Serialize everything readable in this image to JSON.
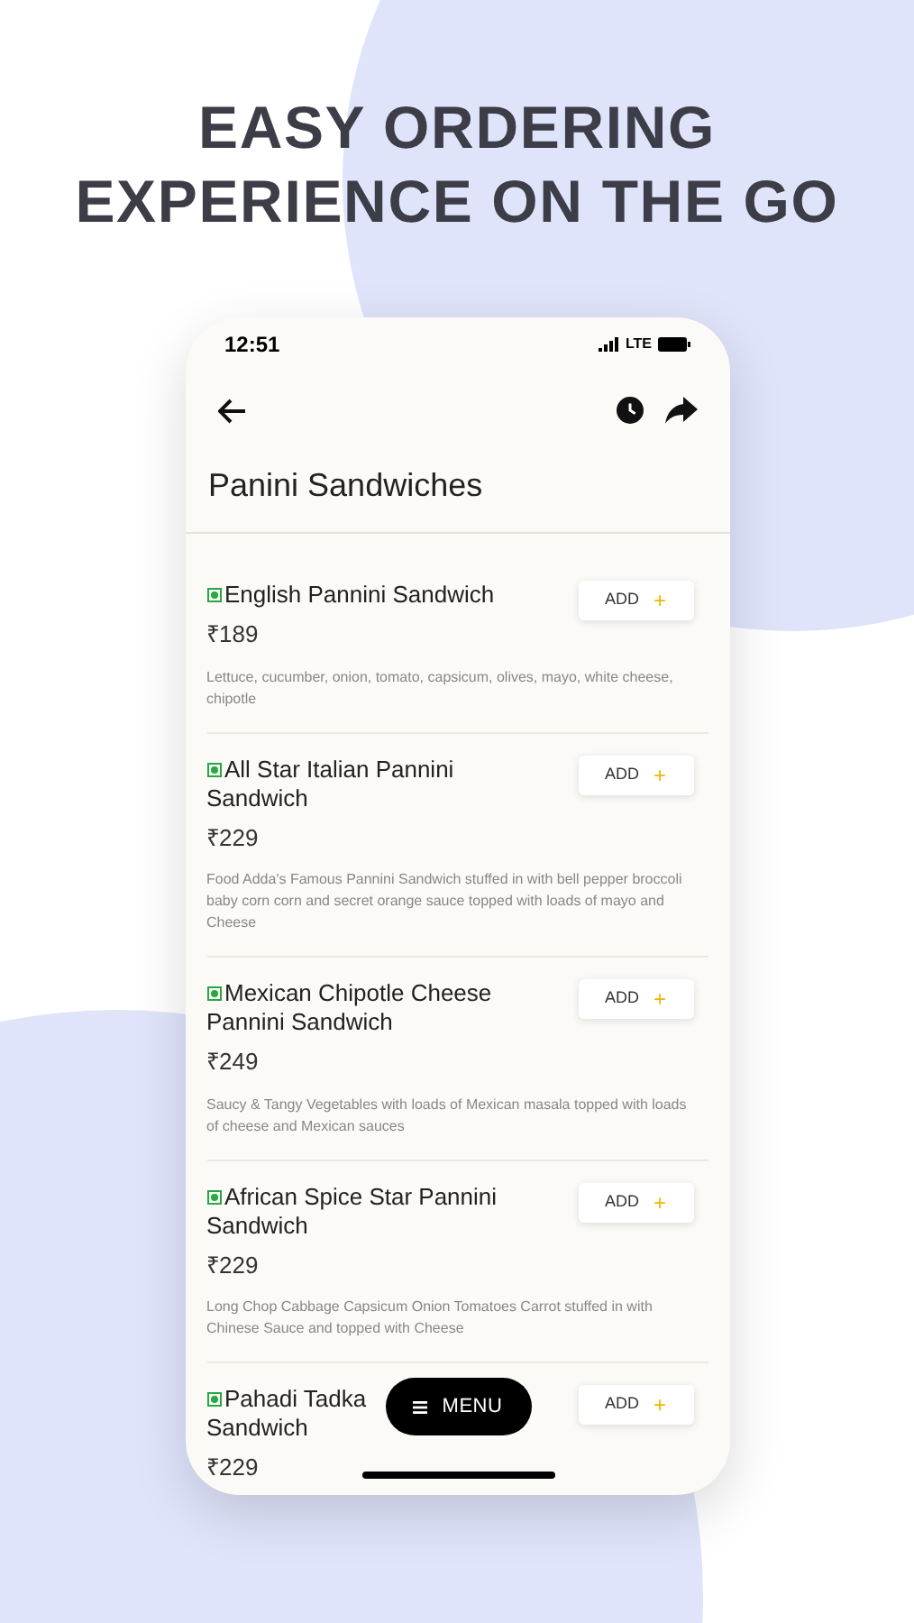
{
  "headline": [
    "EASY ORDERING",
    "EXPERIENCE ON THE GO"
  ],
  "status_bar": {
    "time": "12:51",
    "network": "LTE"
  },
  "title": "Panini Sandwiches",
  "items": [
    {
      "name": [
        "English Pannini Sandwich"
      ],
      "price": "₹189",
      "description": "Lettuce, cucumber, onion, tomato, capsicum, olives, mayo, white cheese, chipotle",
      "button": "ADD",
      "button_icon": "+"
    },
    {
      "name": [
        "All Star Italian Pannini",
        "Sandwich"
      ],
      "price": "₹229",
      "description": "Food Adda's Famous Pannini Sandwich stuffed in with bell pepper broccoli baby corn corn and secret orange sauce topped with loads of mayo and Cheese",
      "button": "ADD",
      "button_icon": "+"
    },
    {
      "name": [
        "Mexican Chipotle Cheese",
        "Pannini Sandwich"
      ],
      "price": "₹249",
      "description": "Saucy & Tangy Vegetables with loads of Mexican masala topped with loads of cheese and Mexican sauces",
      "button": "ADD",
      "button_icon": "+"
    },
    {
      "name": [
        "African Spice Star Pannini",
        "Sandwich"
      ],
      "price": "₹229",
      "description": "Long Chop Cabbage Capsicum Onion Tomatoes Carrot stuffed in with Chinese Sauce and topped with Cheese",
      "button": "ADD",
      "button_icon": "+"
    },
    {
      "name": [
        "Pahadi Tadka",
        "Sandwich"
      ],
      "price": "₹229",
      "button": "ADD",
      "button_icon": "+"
    }
  ],
  "menu_button": "MENU"
}
